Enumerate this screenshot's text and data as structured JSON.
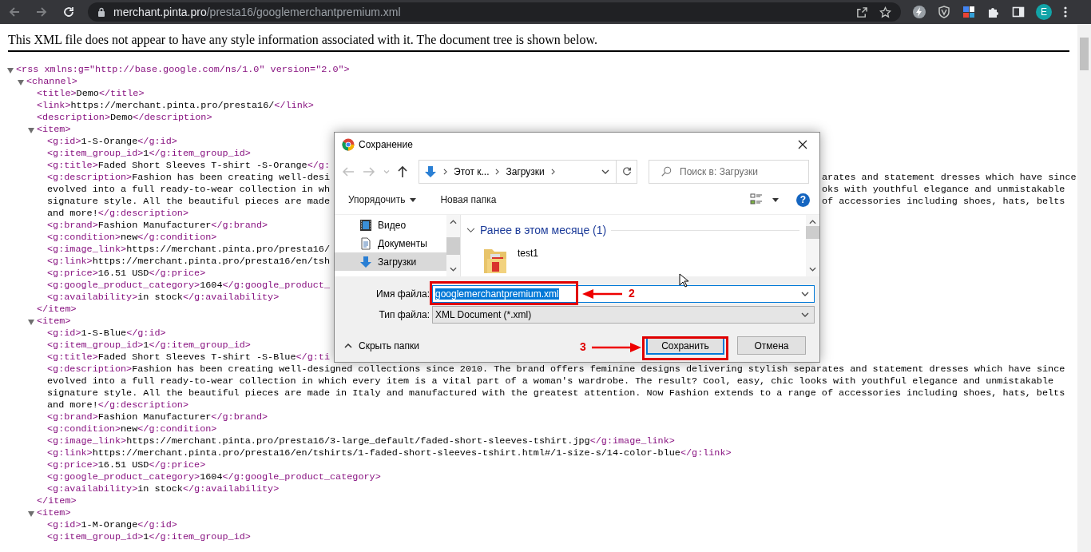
{
  "browser": {
    "nav": [
      {
        "kind": "back",
        "disabled": true
      },
      {
        "kind": "forward",
        "disabled": true
      },
      {
        "kind": "reload",
        "disabled": false
      }
    ],
    "url": {
      "host": "merchant.pinta.pro",
      "path": "/presta16/googlemerchantpremium.xml"
    },
    "profile": "E"
  },
  "xml_viewer": {
    "notice": "This XML file does not appear to have any style information associated with it. The document tree is shown below.",
    "tree": [
      {
        "open": "<rss xmlns:g=\"http://base.google.com/ns/1.0\" version=\"2.0\">",
        "expanded": true,
        "children": [
          {
            "open": "<channel>",
            "expanded": true,
            "children": [
              {
                "open": "<title>",
                "text": "Demo",
                "close": "</title>"
              },
              {
                "open": "<link>",
                "text": "https://merchant.pinta.pro/presta16/",
                "close": "</link>"
              },
              {
                "open": "<description>",
                "text": "Demo",
                "close": "</description>"
              },
              {
                "open": "<item>",
                "expanded": true,
                "close": "</item>",
                "children": [
                  {
                    "open": "<g:id>",
                    "text": "1-S-Orange",
                    "close": "</g:id>"
                  },
                  {
                    "open": "<g:item_group_id>",
                    "text": "1",
                    "close": "</g:item_group_id>"
                  },
                  {
                    "open": "<g:title>",
                    "text": "Faded Short Sleeves T-shirt -S-Orange",
                    "close": "</g:"
                  },
                  {
                    "open": "<g:description>",
                    "lines": [
                      {
                        "text": "Fashion has been creating well-desi",
                        "right": "arates and statement dresses which have since"
                      },
                      {
                        "text": "evolved into a full ready-to-wear collection in wh",
                        "right": "oks with youthful elegance and unmistakable"
                      },
                      {
                        "text": "signature style. All the beautiful pieces are made",
                        "right": "of accessories including shoes, hats, belts"
                      },
                      {
                        "text": "and more!"
                      }
                    ],
                    "close": "</g:description>"
                  },
                  {
                    "open": "<g:brand>",
                    "text": "Fashion Manufacturer",
                    "close": "</g:brand>"
                  },
                  {
                    "open": "<g:condition>",
                    "text": "new",
                    "close": "</g:condition>"
                  },
                  {
                    "open": "<g:image_link>",
                    "text": "https://merchant.pinta.pro/presta16/"
                  },
                  {
                    "open": "<g:link>",
                    "text": "https://merchant.pinta.pro/presta16/en/tsh"
                  },
                  {
                    "open": "<g:price>",
                    "text": "16.51 USD",
                    "close": "</g:price>"
                  },
                  {
                    "open": "<g:google_product_category>",
                    "text": "1604",
                    "close": "</g:google_product_"
                  },
                  {
                    "open": "<g:availability>",
                    "text": "in stock",
                    "close": "</g:availability>"
                  }
                ]
              },
              {
                "open": "<item>",
                "expanded": true,
                "close": "</item>",
                "children": [
                  {
                    "open": "<g:id>",
                    "text": "1-S-Blue",
                    "close": "</g:id>"
                  },
                  {
                    "open": "<g:item_group_id>",
                    "text": "1",
                    "close": "</g:item_group_id>"
                  },
                  {
                    "open": "<g:title>",
                    "text": "Faded Short Sleeves T-shirt -S-Blue",
                    "close": "</g:ti"
                  },
                  {
                    "open": "<g:description>",
                    "lines": [
                      {
                        "text": "Fashion has been creating well-designed collections since 2010. The brand offers feminine designs delivering stylish separates and statement dresses which have since"
                      },
                      {
                        "text": "evolved into a full ready-to-wear collection in which every item is a vital part of a woman's wardrobe. The result? Cool, easy, chic looks with youthful elegance and unmistakable"
                      },
                      {
                        "text": "signature style. All the beautiful pieces are made in Italy and manufactured with the greatest attention. Now Fashion extends to a range of accessories including shoes, hats, belts"
                      },
                      {
                        "text": "and more!"
                      }
                    ],
                    "close": "</g:description>"
                  },
                  {
                    "open": "<g:brand>",
                    "text": "Fashion Manufacturer",
                    "close": "</g:brand>"
                  },
                  {
                    "open": "<g:condition>",
                    "text": "new",
                    "close": "</g:condition>"
                  },
                  {
                    "open": "<g:image_link>",
                    "text": "https://merchant.pinta.pro/presta16/3-large_default/faded-short-sleeves-tshirt.jpg",
                    "close": "</g:image_link>"
                  },
                  {
                    "open": "<g:link>",
                    "text": "https://merchant.pinta.pro/presta16/en/tshirts/1-faded-short-sleeves-tshirt.html#/1-size-s/14-color-blue",
                    "close": "</g:link>"
                  },
                  {
                    "open": "<g:price>",
                    "text": "16.51 USD",
                    "close": "</g:price>"
                  },
                  {
                    "open": "<g:google_product_category>",
                    "text": "1604",
                    "close": "</g:google_product_category>"
                  },
                  {
                    "open": "<g:availability>",
                    "text": "in stock",
                    "close": "</g:availability>"
                  }
                ]
              },
              {
                "open": "<item>",
                "expanded": true,
                "children": [
                  {
                    "open": "<g:id>",
                    "text": "1-M-Orange",
                    "close": "</g:id>"
                  },
                  {
                    "open": "<g:item_group_id>",
                    "text": "1",
                    "close": "</g:item_group_id>"
                  }
                ]
              }
            ]
          }
        ]
      }
    ]
  },
  "save_dialog": {
    "title": "Сохранение",
    "nav": [
      {
        "kind": "back",
        "disabled": true
      },
      {
        "kind": "forward",
        "disabled": true
      },
      {
        "kind": "recent",
        "disabled": true
      },
      {
        "kind": "up",
        "disabled": false
      }
    ],
    "breadcrumb": [
      "Этот к...",
      "Загрузки"
    ],
    "search": {
      "placeholder": "Поиск в: Загрузки"
    },
    "toolbar": {
      "organize": "Упорядочить",
      "new_folder": "Новая папка",
      "help": "?"
    },
    "nav_pane": [
      {
        "label": "Видео",
        "kind": "video",
        "selected": false
      },
      {
        "label": "Документы",
        "kind": "documents",
        "selected": false
      },
      {
        "label": "Загрузки",
        "kind": "downloads",
        "selected": true
      }
    ],
    "file_group": {
      "title": "Ранее в этом месяце (1)",
      "expanded": true,
      "files": [
        {
          "name": "test1"
        }
      ]
    },
    "file_name": {
      "label": "Имя файла:",
      "value": "googlemerchantpremium.xml",
      "text_selected": true,
      "step": "2"
    },
    "file_type": {
      "label": "Тип файла:",
      "value": "XML Document (*.xml)"
    },
    "hide_folders": "Скрыть папки",
    "buttons": [
      {
        "label": "Сохранить",
        "kind": "primary",
        "step": "3"
      },
      {
        "label": "Отмена",
        "kind": "cancel"
      }
    ]
  }
}
